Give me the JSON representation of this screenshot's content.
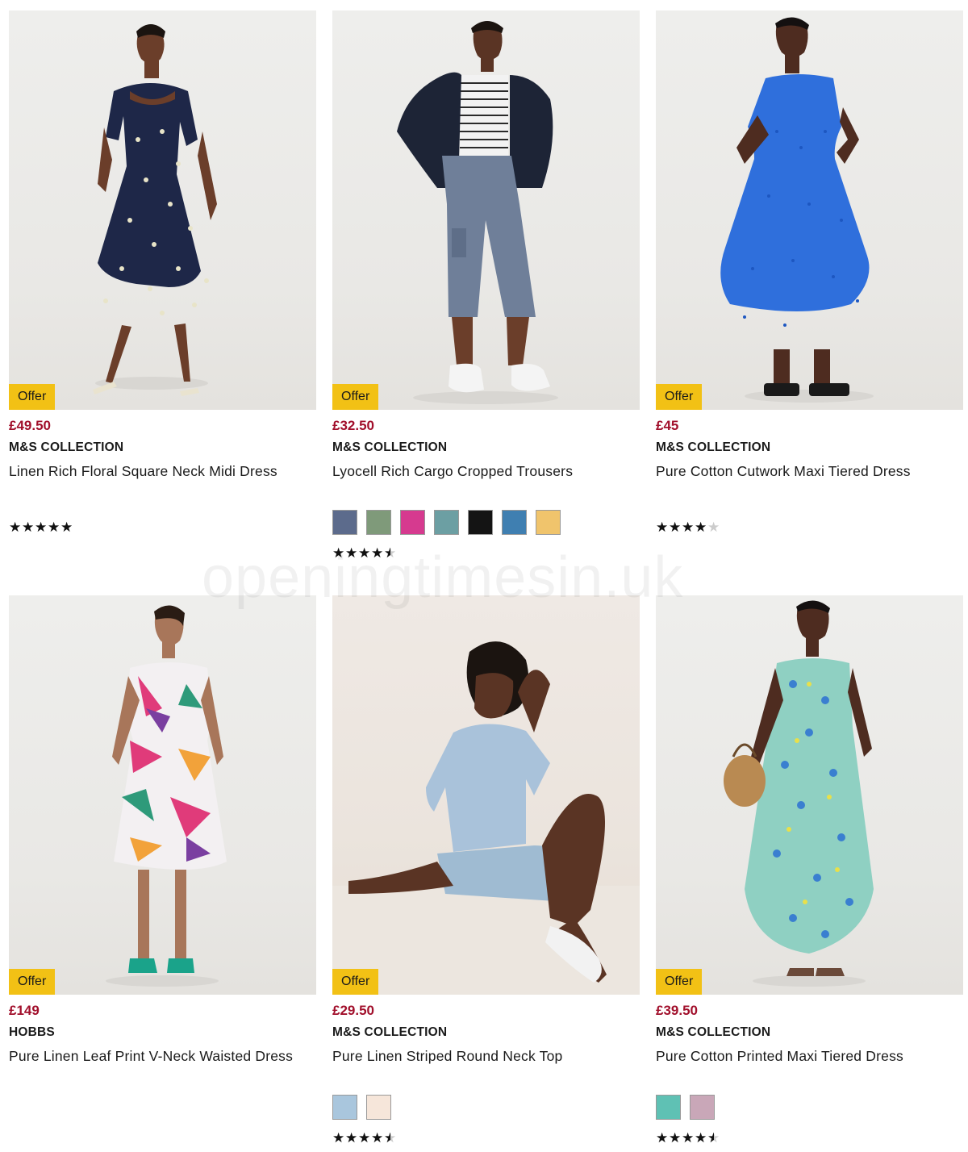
{
  "watermark": "openingtimesin.uk",
  "products": [
    {
      "badge": "Offer",
      "price": "£49.50",
      "brand": "M&S COLLECTION",
      "name": "Linen Rich Floral Square Neck Midi Dress",
      "rating": 5,
      "swatches": []
    },
    {
      "badge": "Offer",
      "price": "£32.50",
      "brand": "M&S COLLECTION",
      "name": "Lyocell Rich Cargo Cropped Trousers",
      "rating": 4.5,
      "swatches": [
        "#5c6b8c",
        "#7f9a7a",
        "#d63a8f",
        "#6c9fa3",
        "#141414",
        "#3f7fb1",
        "#f0c46c"
      ]
    },
    {
      "badge": "Offer",
      "price": "£45",
      "brand": "M&S COLLECTION",
      "name": "Pure Cotton Cutwork Maxi Tiered Dress",
      "rating": 4,
      "swatches": []
    },
    {
      "badge": "Offer",
      "price": "£149",
      "brand": "HOBBS",
      "name": "Pure Linen Leaf Print V-Neck Waisted Dress",
      "rating": null,
      "swatches": []
    },
    {
      "badge": "Offer",
      "price": "£29.50",
      "brand": "M&S COLLECTION",
      "name": "Pure Linen Striped Round Neck Top",
      "rating": 4.5,
      "swatches": [
        "#a9c6dd",
        "#f6e6da"
      ]
    },
    {
      "badge": "Offer",
      "price": "£39.50",
      "brand": "M&S COLLECTION",
      "name": "Pure Cotton Printed Maxi Tiered Dress",
      "rating": 4.5,
      "swatches": [
        "#5fc1b4",
        "#c9a7b8"
      ]
    }
  ]
}
